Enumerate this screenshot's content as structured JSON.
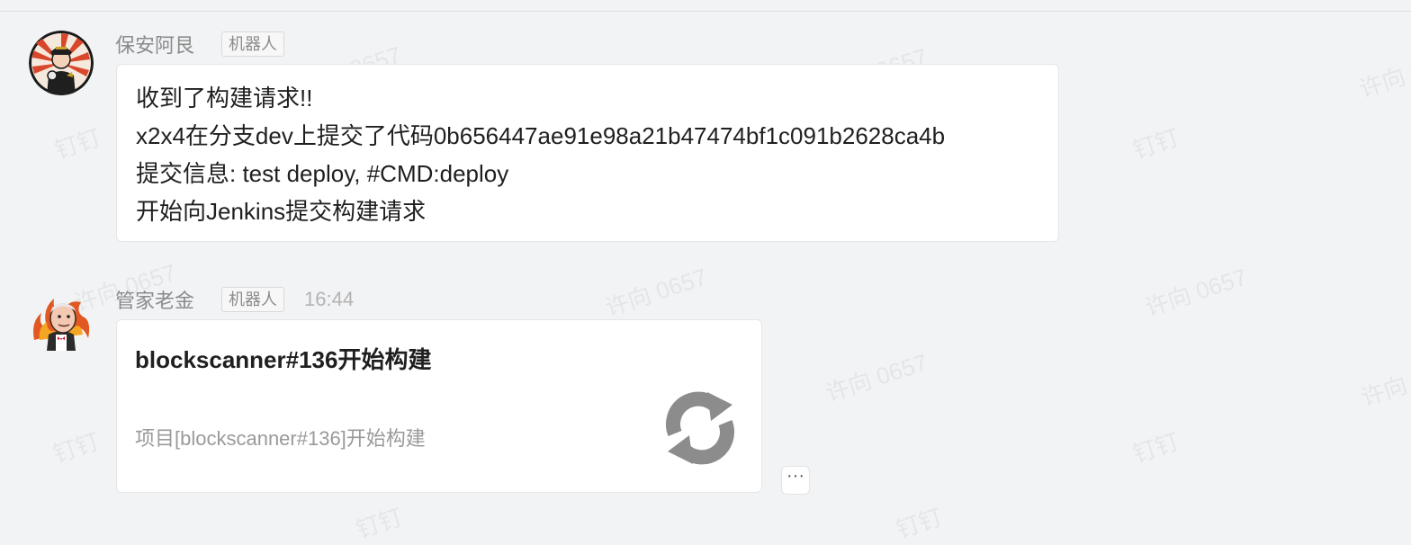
{
  "watermarks": [
    "许向 0657",
    "钉钉"
  ],
  "messages": [
    {
      "sender": "保安阿艮",
      "badge": "机器人",
      "lines": [
        "收到了构建请求!!",
        "x2x4在分支dev上提交了代码0b656447ae91e98a21b47474bf1c091b2628ca4b",
        "提交信息: test deploy, #CMD:deploy",
        "开始向Jenkins提交构建请求"
      ]
    },
    {
      "sender": "管家老金",
      "badge": "机器人",
      "time": "16:44",
      "card": {
        "title": "blockscanner#136开始构建",
        "description": "项目[blockscanner#136]开始构建",
        "icon": "refresh-icon",
        "icon_color": "#8c8c8c"
      },
      "more_label": "···"
    }
  ],
  "colors": {
    "background": "#f2f3f5",
    "bubble": "#ffffff",
    "secondary_text": "#8b8b8b"
  }
}
